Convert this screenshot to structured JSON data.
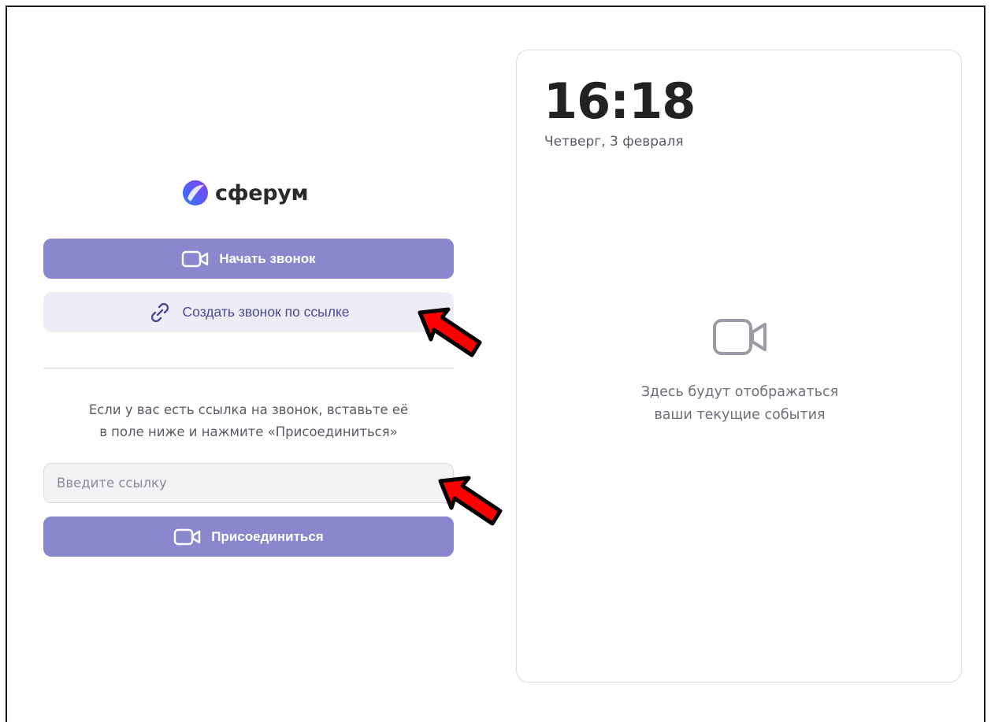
{
  "brand": {
    "name": "сферум",
    "logo_icon": "sferum-logo-icon",
    "colors": {
      "gradient_start": "#2a7bff",
      "gradient_end": "#8a3cf0"
    }
  },
  "actions": {
    "start_call_label": "Начать звонок",
    "create_link_call_label": "Создать звонок по ссылке",
    "join_label": "Присоединиться"
  },
  "join": {
    "hint_line1": "Если у вас есть ссылка на звонок, вставьте её",
    "hint_line2": "в поле ниже и нажмите «Присоединиться»",
    "input_value": "",
    "input_placeholder": "Введите ссылку"
  },
  "panel": {
    "time": "16:18",
    "date": "Четверг, 3 февраля",
    "empty_line1": "Здесь будут отображаться",
    "empty_line2": "ваши текущие события"
  },
  "colors": {
    "primary_button": "#8b87cf",
    "secondary_button": "#eeedf7",
    "secondary_text": "#4b4794",
    "annotation_arrow": "#ff0000"
  },
  "icons": {
    "video": "video-camera-icon",
    "link": "link-icon",
    "arrow": "red-arrow-icon"
  }
}
